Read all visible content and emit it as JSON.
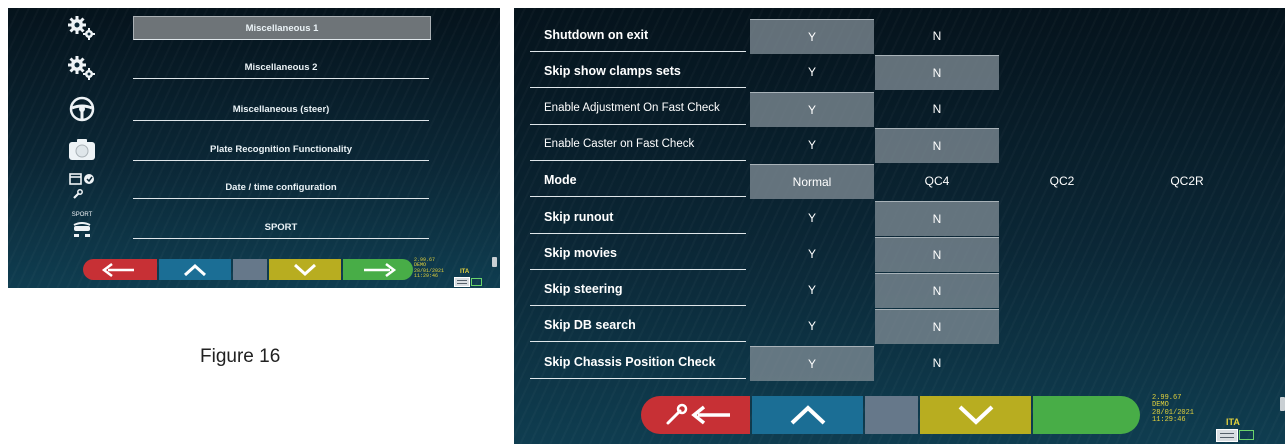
{
  "figure_caption": "Figure 16",
  "left_screen": {
    "menu": [
      {
        "label": "Miscellaneous 1",
        "icon": "gears-icon",
        "selected": true
      },
      {
        "label": "Miscellaneous 2",
        "icon": "gears-icon",
        "selected": false
      },
      {
        "label": "Miscellaneous (steer)",
        "icon": "steering-wheel-icon",
        "selected": false
      },
      {
        "label": "Plate Recognition Functionality",
        "icon": "camera-icon",
        "selected": false
      },
      {
        "label": "Date / time configuration",
        "icon": "calendar-clock-icon",
        "selected": false
      },
      {
        "label": "SPORT",
        "icon": "sport-car-icon",
        "icon_text": "SPORT",
        "selected": false
      }
    ],
    "status": {
      "version": "2.99.67",
      "mode": "DEMO",
      "date": "28/01/2021",
      "time": "11:29:46",
      "language": "ITA"
    }
  },
  "right_screen": {
    "rows": [
      {
        "label": "Shutdown on exit",
        "bold": true,
        "options": [
          "Y",
          "N"
        ],
        "selected": 0
      },
      {
        "label": "Skip show clamps sets",
        "bold": true,
        "options": [
          "Y",
          "N"
        ],
        "selected": 1
      },
      {
        "label": "Enable Adjustment On Fast Check",
        "bold": false,
        "options": [
          "Y",
          "N"
        ],
        "selected": 0
      },
      {
        "label": "Enable Caster on Fast Check",
        "bold": false,
        "options": [
          "Y",
          "N"
        ],
        "selected": 1
      },
      {
        "label": "Mode",
        "bold": true,
        "options": [
          "Normal",
          "QC4",
          "QC2",
          "QC2R"
        ],
        "selected": 0
      },
      {
        "label": "Skip runout",
        "bold": true,
        "options": [
          "Y",
          "N"
        ],
        "selected": 1
      },
      {
        "label": "Skip movies",
        "bold": true,
        "options": [
          "Y",
          "N"
        ],
        "selected": 1
      },
      {
        "label": "Skip steering",
        "bold": true,
        "options": [
          "Y",
          "N"
        ],
        "selected": 1
      },
      {
        "label": "Skip DB search",
        "bold": true,
        "options": [
          "Y",
          "N"
        ],
        "selected": 1
      },
      {
        "label": "Skip Chassis Position Check",
        "bold": true,
        "options": [
          "Y",
          "N"
        ],
        "selected": 0
      }
    ],
    "status": {
      "version": "2.99.67",
      "mode": "DEMO",
      "date": "28/01/2021",
      "time": "11:29:46",
      "language": "ITA"
    }
  },
  "colors": {
    "red": "#c73035",
    "blue": "#1b6e95",
    "gray": "#66788a",
    "yellow": "#b8ad20",
    "green": "#48ad47",
    "status_text": "#e3d23c"
  }
}
